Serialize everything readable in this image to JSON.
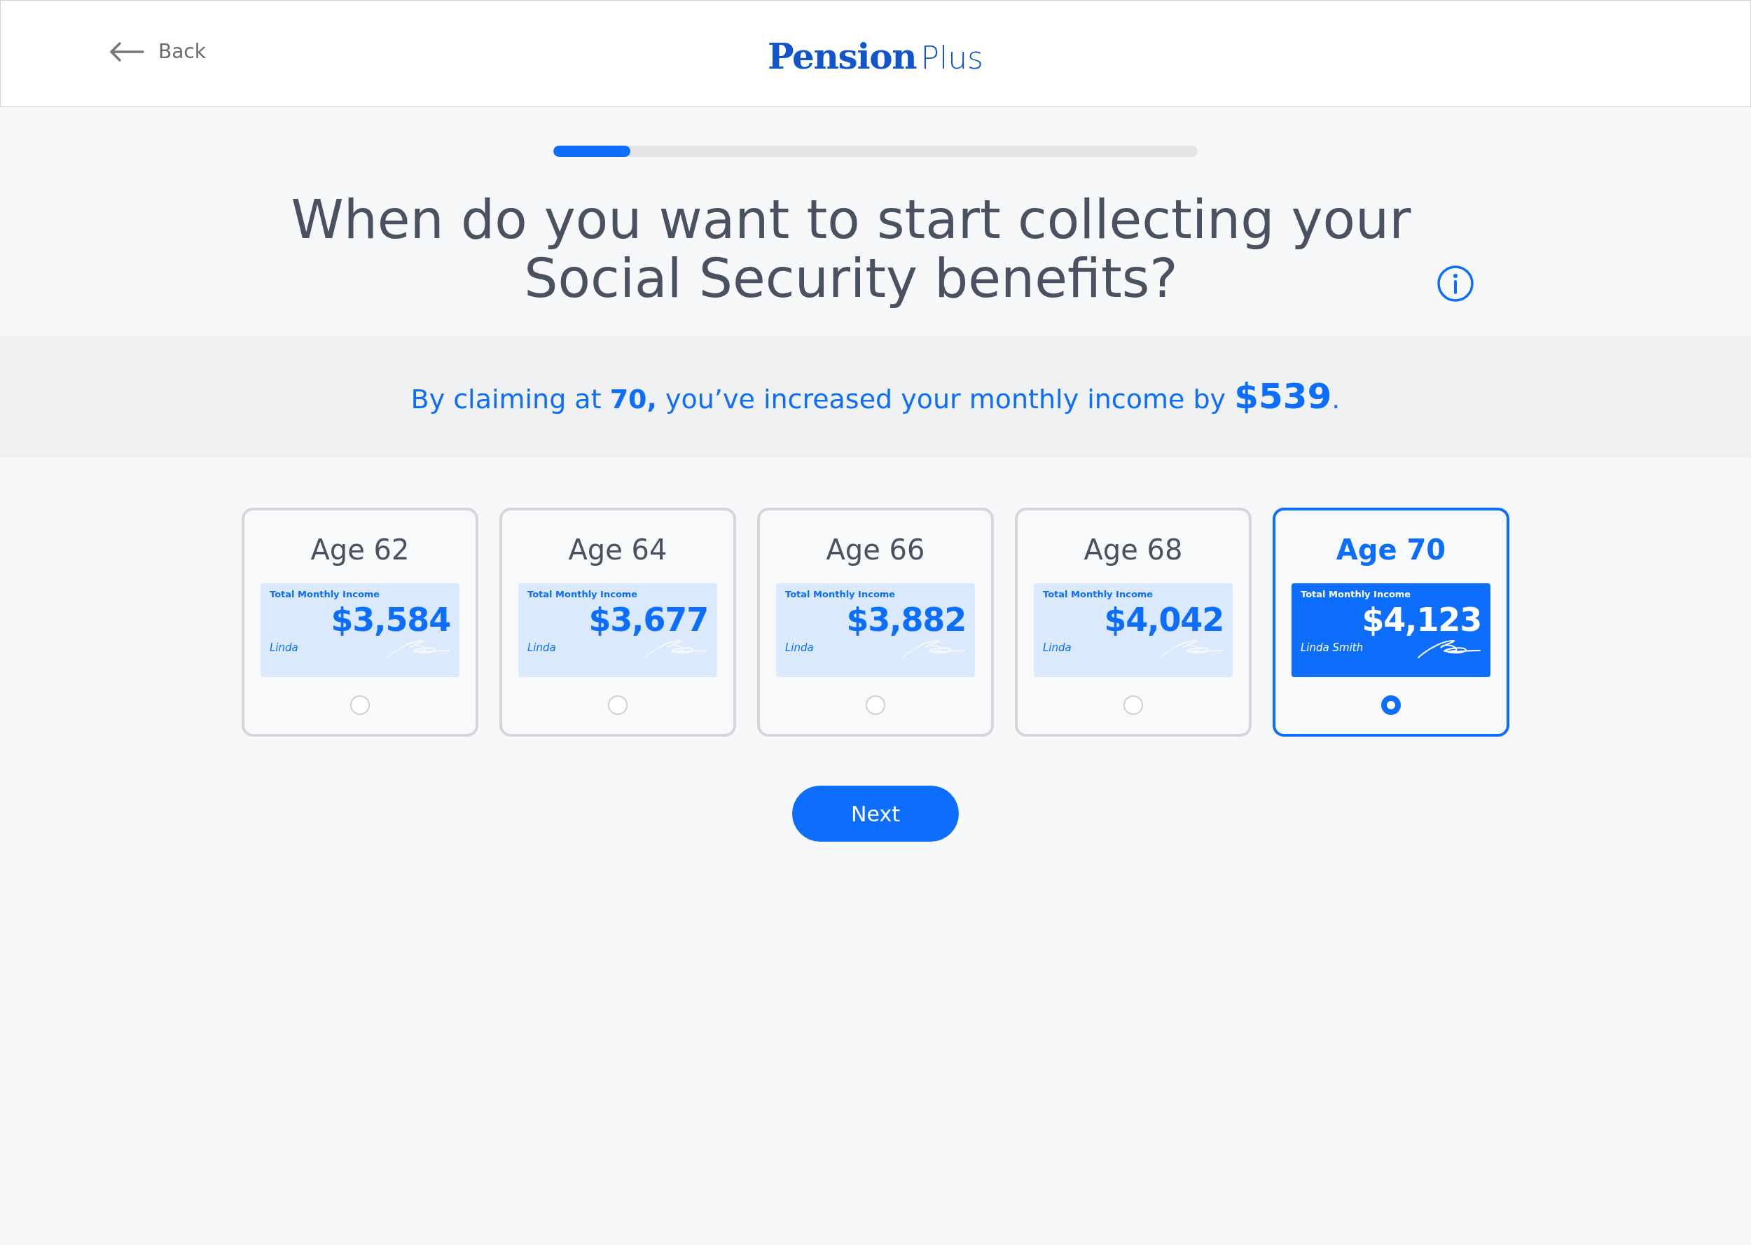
{
  "header": {
    "back_label": "Back",
    "logo": {
      "bold": "Pension",
      "light": "Plus"
    }
  },
  "progress": {
    "level": 0.12
  },
  "question": "When do you want to start collecting your Social Security benefits?",
  "banner": "By claiming at **70,** you’ve increased your monthly income by **$539**.",
  "options": [
    {
      "age": "Age 62",
      "caption": "Total Monthly Income",
      "amount": "$3,584",
      "name": "Linda",
      "selected": false
    },
    {
      "age": "Age 64",
      "caption": "Total Monthly Income",
      "amount": "$3,677",
      "name": "Linda",
      "selected": false
    },
    {
      "age": "Age 66",
      "caption": "Total Monthly Income",
      "amount": "$3,882",
      "name": "Linda",
      "selected": false
    },
    {
      "age": "Age 68",
      "caption": "Total Monthly Income",
      "amount": "$4,042",
      "name": "Linda",
      "selected": false
    },
    {
      "age": "Age 70",
      "caption": "Total Monthly Income",
      "amount": "$4,123",
      "name": "Linda Smith",
      "selected": true
    }
  ],
  "next_button": "Next"
}
